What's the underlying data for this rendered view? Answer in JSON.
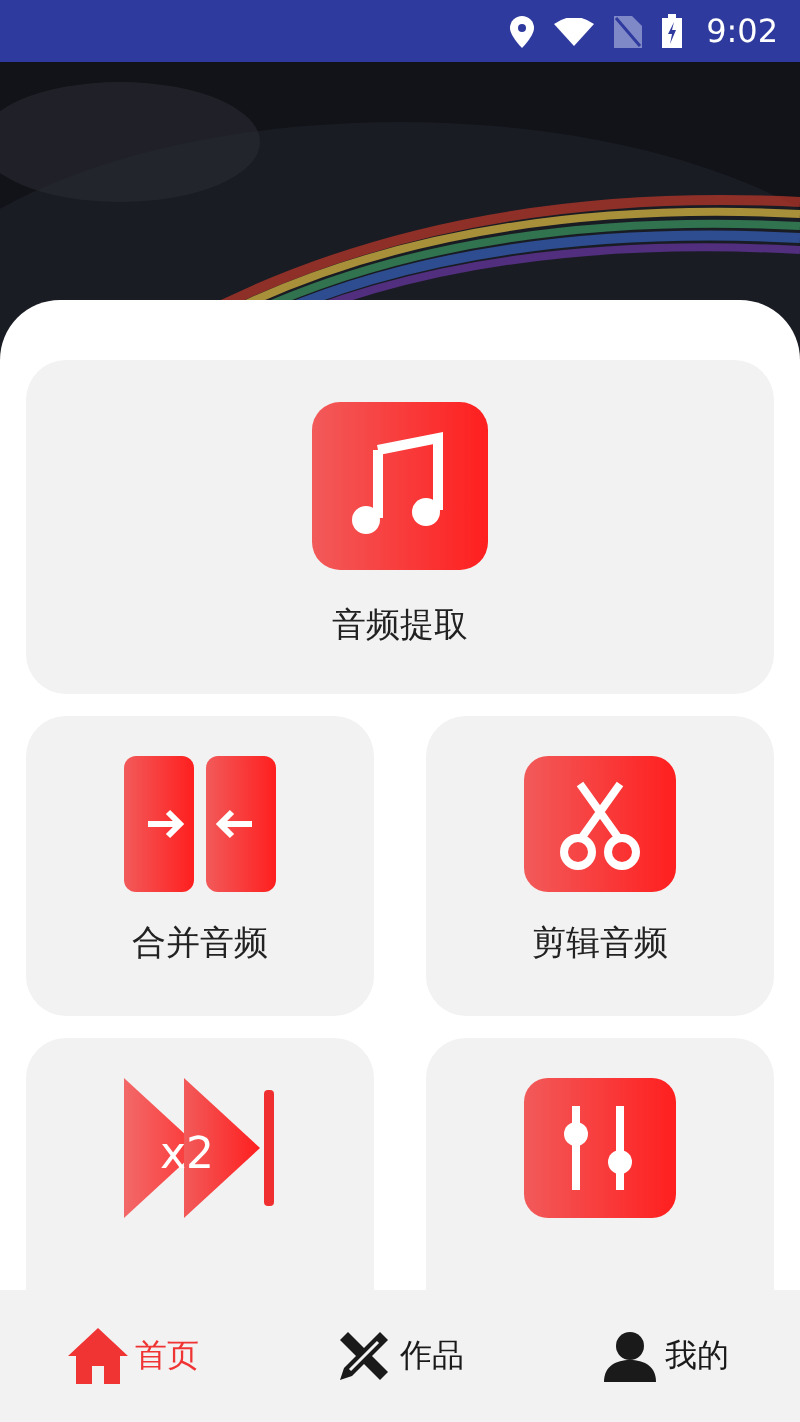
{
  "status_bar": {
    "time": "9:02"
  },
  "tools": [
    {
      "kind": "extract",
      "label": "音频提取",
      "wide": true
    },
    {
      "kind": "merge",
      "label": "合并音频",
      "wide": false
    },
    {
      "kind": "cut",
      "label": "剪辑音频",
      "wide": false
    },
    {
      "kind": "speed",
      "badge": "x2",
      "wide": false
    },
    {
      "kind": "mix",
      "wide": false
    }
  ],
  "nav": [
    {
      "kind": "home",
      "label": "首页",
      "selected": true
    },
    {
      "kind": "works",
      "label": "作品",
      "selected": false
    },
    {
      "kind": "me",
      "label": "我的",
      "selected": false
    }
  ]
}
